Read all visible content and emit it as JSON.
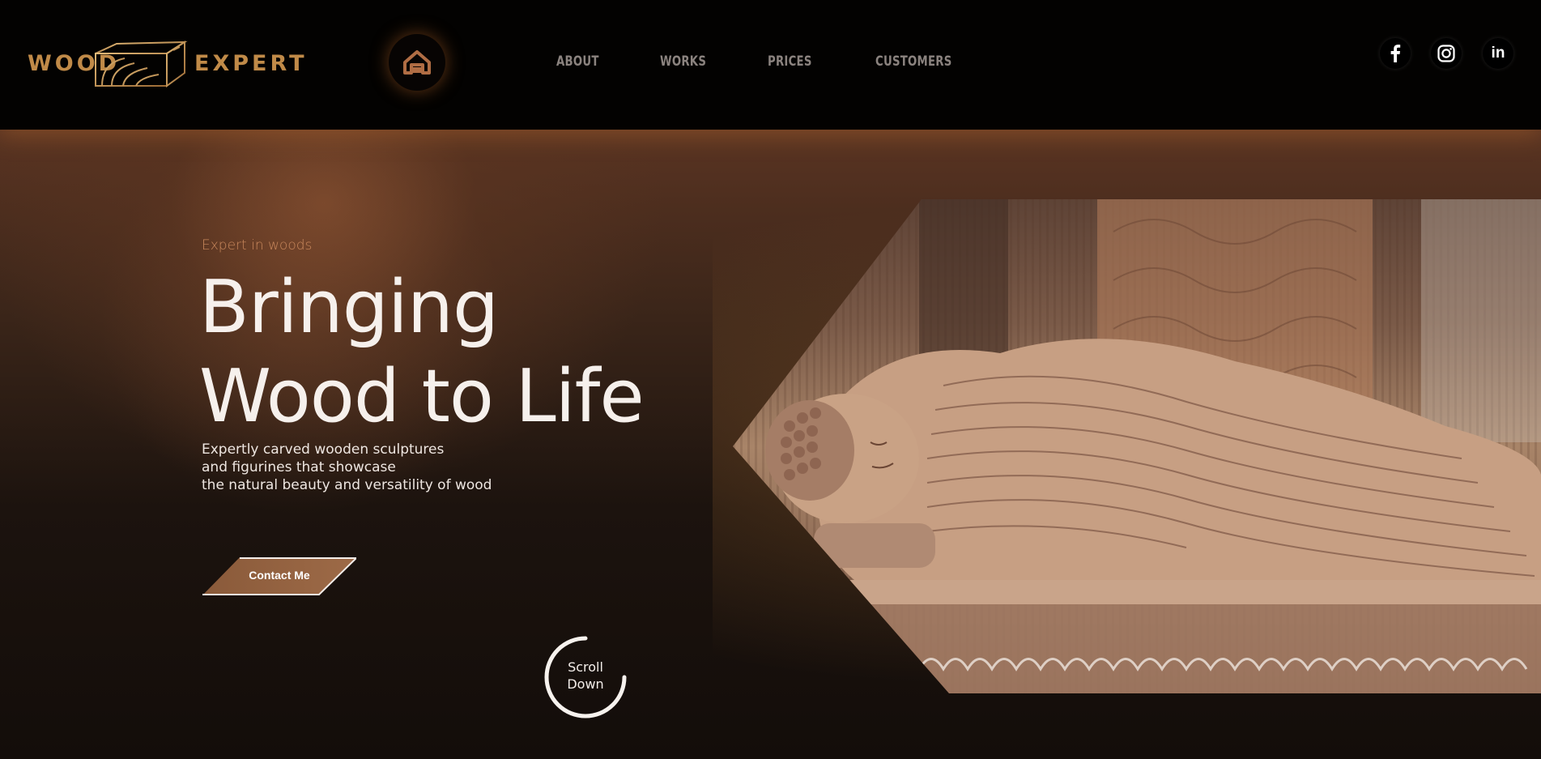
{
  "brand": {
    "word_left": "WOOD",
    "word_right": "EXPERT",
    "mark_icon": "wood-plank-icon",
    "color": "#c08a48"
  },
  "home_button": {
    "icon": "home-icon",
    "color": "#b06d44"
  },
  "nav": {
    "items": [
      {
        "label": "ABOUT"
      },
      {
        "label": "WORKS"
      },
      {
        "label": "PRICES"
      },
      {
        "label": "CUSTOMERS"
      }
    ]
  },
  "social": [
    {
      "icon": "facebook-icon"
    },
    {
      "icon": "instagram-icon"
    },
    {
      "icon": "linkedin-icon",
      "label": "in"
    }
  ],
  "hero": {
    "tagline": "Expert in woods",
    "headline_line1": "Bringing",
    "headline_line2": "Wood to Life",
    "description_lines": [
      "Expertly carved wooden sculptures",
      "and figurines that showcase",
      "the natural beauty and versatility of wood"
    ],
    "cta_label": "Contact Me",
    "scroll_label_line1": "Scroll",
    "scroll_label_line2": "Down",
    "image_subject": "reclining-buddha-wood-carving-image"
  },
  "colors": {
    "accent": "#c8875b",
    "button": "#9d6a47",
    "header_bg": "#030201",
    "hero_bg": "#130d0a"
  }
}
